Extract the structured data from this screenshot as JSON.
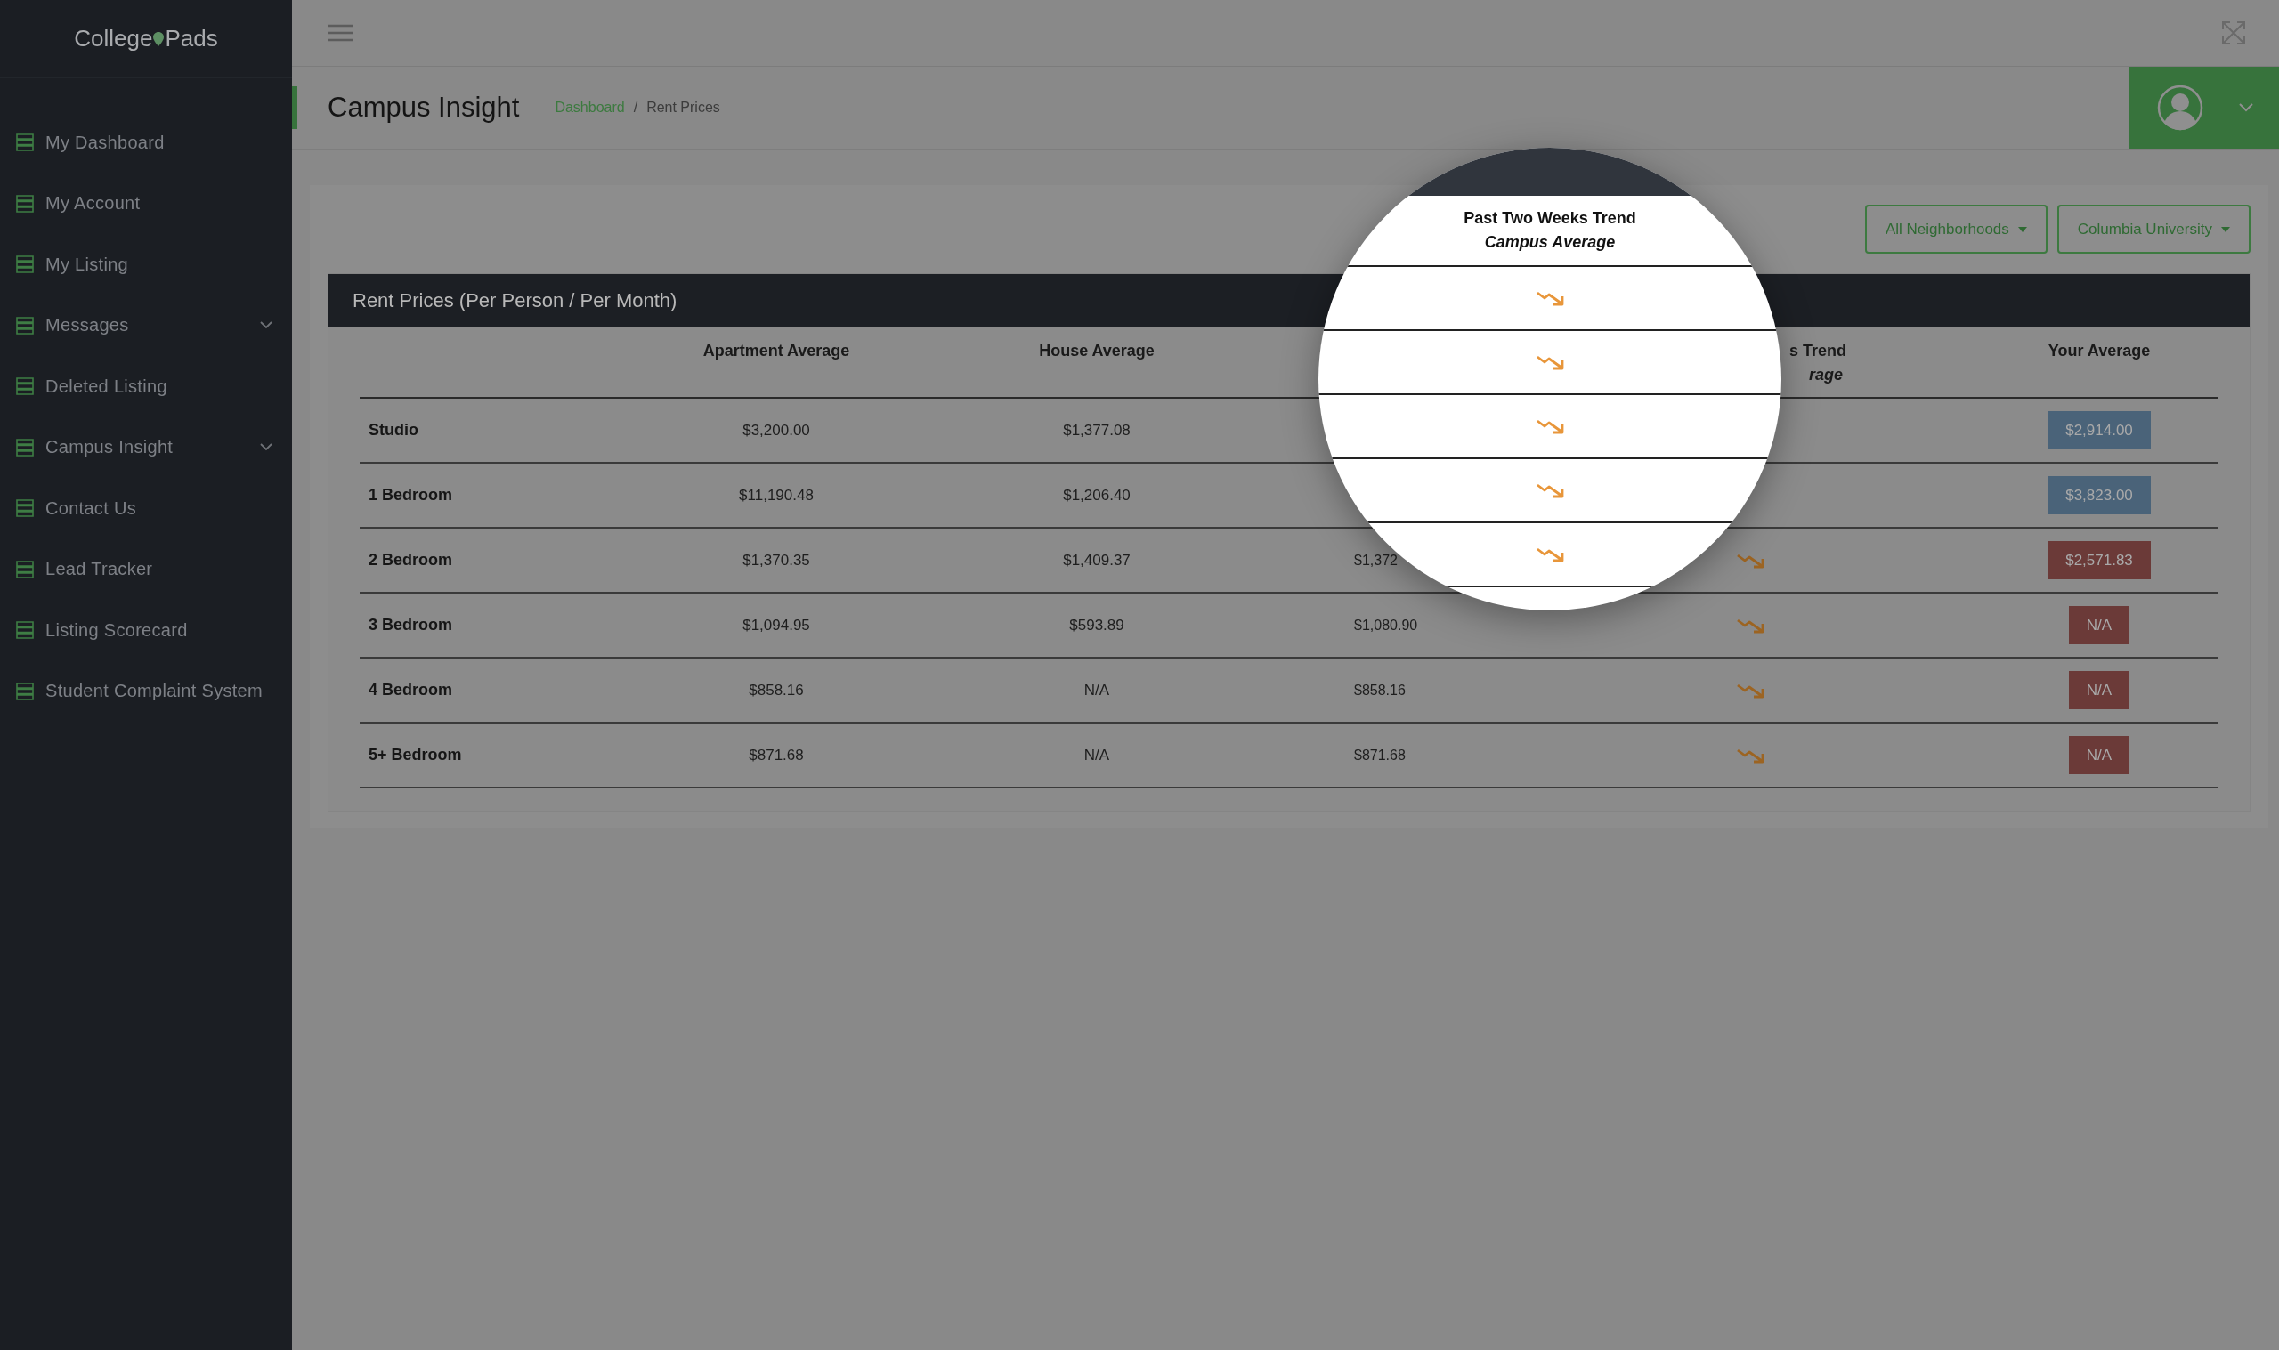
{
  "sidebar": {
    "logo": {
      "left": "College",
      "right": "Pads"
    },
    "items": [
      {
        "label": "My Dashboard",
        "expandable": false
      },
      {
        "label": "My Account",
        "expandable": false
      },
      {
        "label": "My Listing",
        "expandable": false
      },
      {
        "label": "Messages",
        "expandable": true
      },
      {
        "label": "Deleted Listing",
        "expandable": false
      },
      {
        "label": "Campus Insight",
        "expandable": true
      },
      {
        "label": "Contact Us",
        "expandable": false
      },
      {
        "label": "Lead Tracker",
        "expandable": false
      },
      {
        "label": "Listing Scorecard",
        "expandable": false
      },
      {
        "label": "Student Complaint System",
        "expandable": false
      }
    ]
  },
  "page": {
    "title": "Campus Insight",
    "breadcrumb": {
      "link": "Dashboard",
      "separator": "/",
      "current": "Rent Prices"
    }
  },
  "filters": [
    "All Neighborhoods",
    "Columbia University"
  ],
  "table": {
    "title": "Rent Prices (Per Person / Per Month)",
    "columns": {
      "apartment": "Apartment Average",
      "house": "House Average",
      "trend": {
        "line1": "s Trend",
        "line2": "rage"
      },
      "yours": "Your Average"
    },
    "rows": [
      {
        "label": "Studio",
        "apartment": "$3,200.00",
        "house": "$1,377.08",
        "yours": {
          "text": "$2,914.00",
          "color": "#4a6379"
        }
      },
      {
        "label": "1 Bedroom",
        "apartment": "$11,190.48",
        "house": "$1,206.40",
        "yours": {
          "text": "$3,823.00",
          "color": "#4a6379"
        }
      },
      {
        "label": "2 Bedroom",
        "apartment": "$1,370.35",
        "house": "$1,409.37",
        "column_4": "$1,372",
        "falling": true,
        "yours": {
          "text": "$2,571.83",
          "color": "#6b3a38"
        }
      },
      {
        "label": "3 Bedroom",
        "apartment": "$1,094.95",
        "house": "$593.89",
        "column_4": "$1,080.90",
        "falling": true,
        "yours": {
          "text": "N/A",
          "color": "#6b3a38"
        }
      },
      {
        "label": "4 Bedroom",
        "apartment": "$858.16",
        "house": "N/A",
        "column_4": "$858.16",
        "falling": true,
        "yours": {
          "text": "N/A",
          "color": "#6b3a38"
        }
      },
      {
        "label": "5+ Bedroom",
        "apartment": "$871.68",
        "house": "N/A",
        "column_4": "$871.68",
        "falling": true,
        "yours": {
          "text": "N/A",
          "color": "#6b3a38"
        }
      }
    ]
  },
  "magnifier": {
    "header": "Past Two Weeks Trend",
    "subheader": "Campus Average",
    "rows": [
      {
        "falling": true
      },
      {
        "falling": true
      },
      {
        "falling": true
      },
      {
        "falling": true
      },
      {
        "falling": true
      }
    ]
  }
}
